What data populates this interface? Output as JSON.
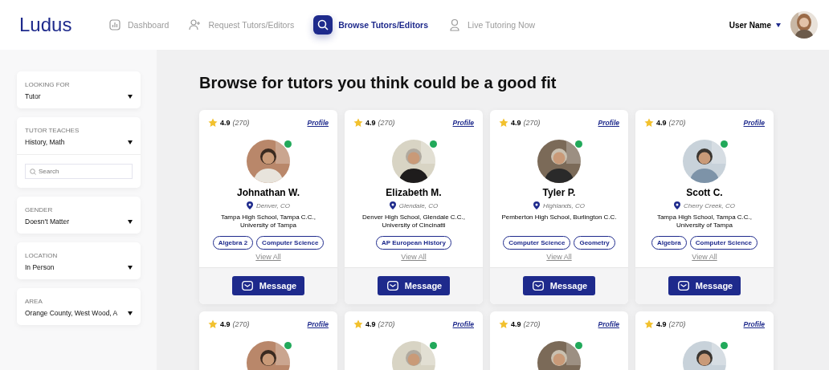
{
  "header": {
    "logo": "Ludus",
    "nav": [
      {
        "label": "Dashboard",
        "kind": "chart",
        "selected": false
      },
      {
        "label": "Request Tutors/Editors",
        "kind": "request",
        "selected": false
      },
      {
        "label": "Browse Tutors/Editors",
        "kind": "browse",
        "selected": true
      },
      {
        "label": "Live Tutoring Now",
        "kind": "live",
        "selected": false
      }
    ],
    "user": {
      "name": "User Name"
    }
  },
  "filters": [
    {
      "label": "LOOKING FOR",
      "value": "Tutor"
    },
    {
      "label": "TUTOR TEACHES",
      "value": "History, Math",
      "search": {
        "placeholder": "Search"
      }
    },
    {
      "label": "GENDER",
      "value": "Doesn't Matter"
    },
    {
      "label": "LOCATION",
      "value": "In Person"
    },
    {
      "label": "AREA",
      "value": "Orange County, West Wood, A"
    }
  ],
  "heading": "Browse for tutors you think could be a good fit",
  "tutors": [
    {
      "rating": "4.9",
      "count": "(270)",
      "profile": "Profile",
      "online": true,
      "name": "Johnathan W.",
      "location": "Denver, CO",
      "schools": "Tampa High School, Tampa C.C., University of Tampa",
      "subjects": [
        "Algebra 2",
        "Computer Science"
      ],
      "view_all": "View All",
      "message": "Message"
    },
    {
      "rating": "4.9",
      "count": "(270)",
      "profile": "Profile",
      "online": true,
      "name": "Elizabeth M.",
      "location": "Glendale, CO",
      "schools": "Denver High School, Glendale C.C., University of Cincinatti",
      "subjects": [
        "AP European History"
      ],
      "view_all": "View All",
      "message": "Message"
    },
    {
      "rating": "4.9",
      "count": "(270)",
      "profile": "Profile",
      "online": true,
      "name": "Tyler P.",
      "location": "Highlands, CO",
      "schools": "Pemberton High School, Burlington C.C.",
      "subjects": [
        "Computer Science",
        "Geometry"
      ],
      "view_all": "View All",
      "message": "Message"
    },
    {
      "rating": "4.9",
      "count": "(270)",
      "profile": "Profile",
      "online": true,
      "name": "Scott C.",
      "location": "Cherry Creek, CO",
      "schools": "Tampa High School, Tampa C.C., University of Tampa",
      "subjects": [
        "Algebra",
        "Computer Science"
      ],
      "view_all": "View All",
      "message": "Message"
    },
    {
      "rating": "4.9",
      "count": "(270)",
      "profile": "Profile",
      "online": true
    },
    {
      "rating": "4.9",
      "count": "(270)",
      "profile": "Profile",
      "online": true
    },
    {
      "rating": "4.9",
      "count": "(270)",
      "profile": "Profile",
      "online": true
    },
    {
      "rating": "4.9",
      "count": "(270)",
      "profile": "Profile",
      "online": true
    }
  ]
}
